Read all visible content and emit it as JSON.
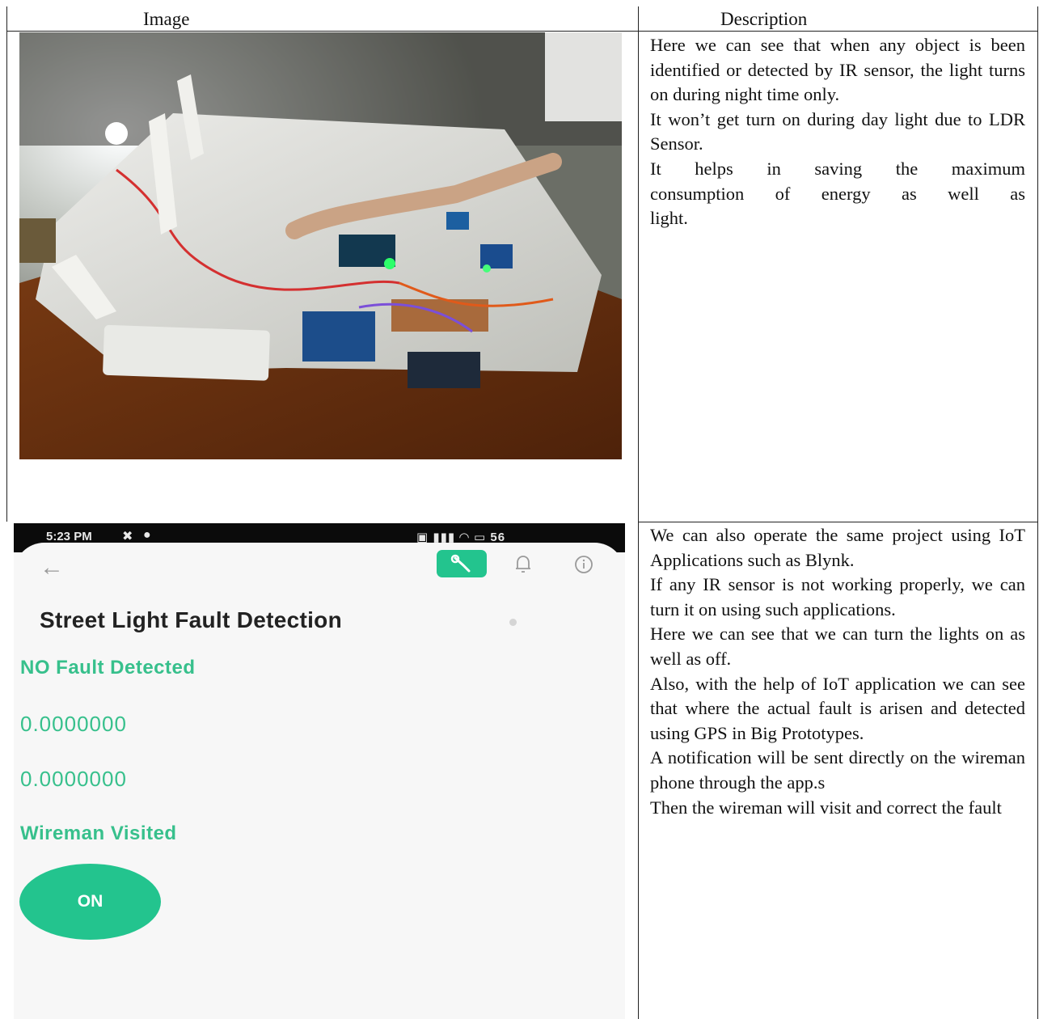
{
  "table": {
    "headers": {
      "image": "Image",
      "description": "Description"
    },
    "rows": [
      {
        "description": [
          "Here we can see that when any object is been identified or detected by IR sensor, the light turns on during night time only.",
          "It won’t get turn on during day light due to LDR Sensor.",
          "It helps in saving the maximum consumption of energy as well as light."
        ]
      },
      {
        "description": [
          "We can also operate the same project using IoT Applications such as Blynk.",
          "If any IR sensor is not working properly, we can turn it on using such applications.",
          "Here we can see that we can turn the lights on as well as off.",
          "Also, with the help of IoT application we can see that where the actual fault is arisen and detected using GPS in Big Prototypes.",
          "A notification will be sent directly on the wireman phone through the app.s",
          "Then the wireman will visit and correct the fault"
        ]
      }
    ]
  },
  "phone": {
    "status_time": "5:23 PM",
    "battery": "56",
    "app_title": "Street Light Fault Detection",
    "fault_status": "NO Fault Detected",
    "latitude": "0.0000000",
    "longitude": "0.0000000",
    "wireman_status": "Wireman Visited",
    "switch_label": "ON",
    "accent_color": "#23c48e"
  }
}
